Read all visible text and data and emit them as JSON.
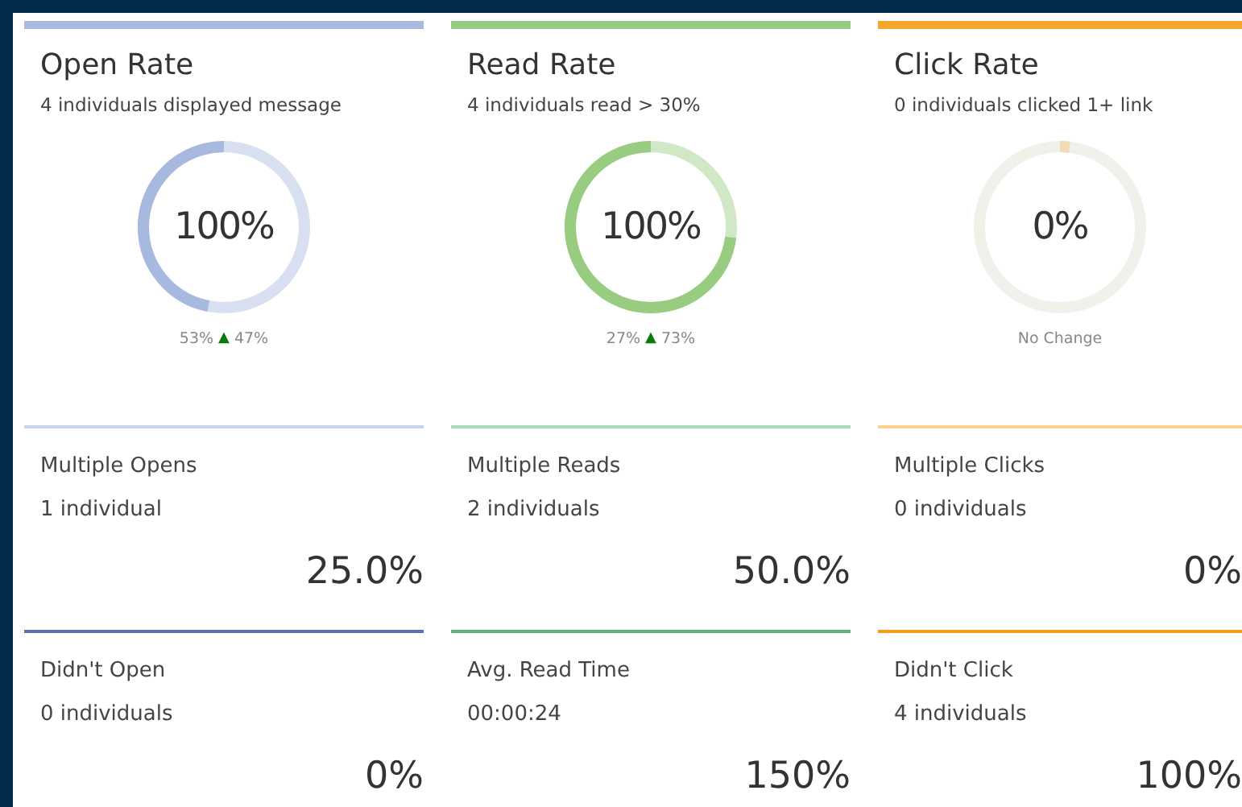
{
  "cards": [
    {
      "title": "Open Rate",
      "subtitle": "4 individuals displayed message",
      "color": "#a8b9e0",
      "ring": {
        "value": "100%",
        "level": 0.47
      },
      "footer": {
        "kind": "trend",
        "previous": "53%",
        "arrow": "▲",
        "change": "47%"
      },
      "stats": [
        {
          "label": "Multiple Opens",
          "detail": "1 individual",
          "value": "25.0%",
          "color": "#c8d4ee"
        },
        {
          "label": "Didn't Open",
          "detail": "0 individuals",
          "value": "0%",
          "color": "#5a72bd"
        }
      ]
    },
    {
      "title": "Read Rate",
      "subtitle": "4 individuals read > 30%",
      "color": "#98cc80",
      "ring": {
        "value": "100%",
        "level": 0.73
      },
      "footer": {
        "kind": "trend",
        "previous": "27%",
        "arrow": "▲",
        "change": "73%"
      },
      "stats": [
        {
          "label": "Multiple Reads",
          "detail": "2 individuals",
          "value": "50.0%",
          "color": "#a8dcb8"
        },
        {
          "label": "Avg. Read Time",
          "detail": "00:00:24",
          "value": "150%",
          "color": "#5cb47c"
        }
      ]
    },
    {
      "title": "Click Rate",
      "subtitle": "0 individuals clicked 1+ link",
      "color": "#f5a52a",
      "ring": {
        "value": "0%",
        "level": 0
      },
      "footer": {
        "kind": "note",
        "text": "No Change"
      },
      "stats": [
        {
          "label": "Multiple Clicks",
          "detail": "0 individuals",
          "value": "0%",
          "color": "#fad28a"
        },
        {
          "label": "Didn't Click",
          "detail": "4 individuals",
          "value": "100%",
          "color": "#f29d1c"
        }
      ]
    }
  ]
}
